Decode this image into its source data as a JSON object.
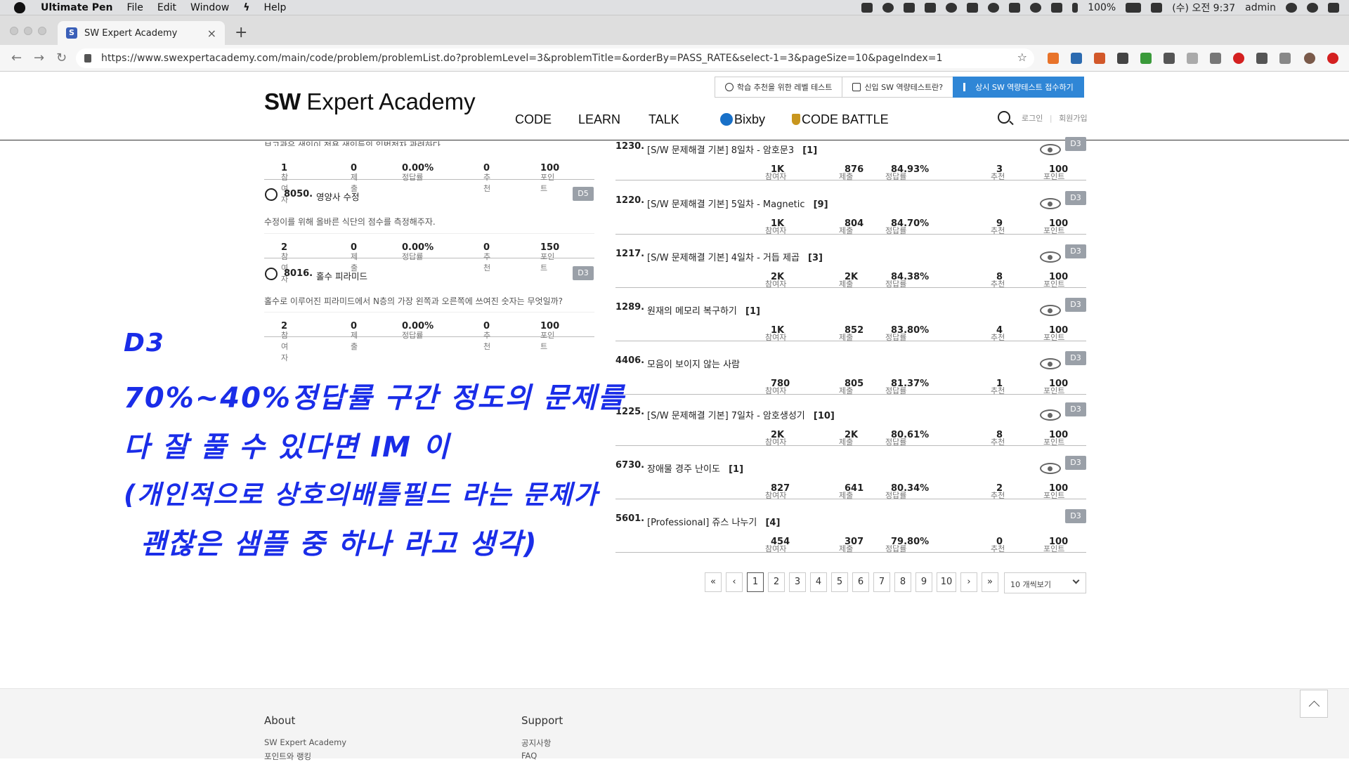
{
  "menubar": {
    "app": "Ultimate Pen",
    "items": [
      "File",
      "Edit",
      "Window",
      "Help"
    ],
    "battery": "100%",
    "clock": "(수) 오전 9:37",
    "user": "admin"
  },
  "browser": {
    "tab_title": "SW Expert Academy",
    "favicon_letter": "S",
    "new_tab": "+",
    "tab_close": "×",
    "url": "https://www.swexpertacademy.com/main/code/problem/problemList.do?problemLevel=3&problemTitle=&orderBy=PASS_RATE&select-1=3&pageSize=10&pageIndex=1"
  },
  "header": {
    "logo_bold": "SW",
    "logo_rest": " Expert Academy",
    "top_buttons": [
      "학습 추천을 위한 레벨 테스트",
      "신입 SW 역량테스트란?",
      "상시 SW 역량테스트 접수하기"
    ],
    "nav": [
      "CODE",
      "LEARN",
      "TALK",
      "Bixby",
      "CODE BATTLE"
    ],
    "login": "로그인",
    "signup": "회원가입",
    "sep": "|"
  },
  "stat_labels": {
    "participants": "참여자",
    "submissions": "제출",
    "pass_rate": "정답률",
    "recommend": "추천",
    "points": "포인트"
  },
  "left_list": {
    "partial_desc": "보고관은 색인이 전용 색인들의 입법전자 관련하다.",
    "first_stats": {
      "participants": "1",
      "submissions": "0",
      "pass_rate": "0.00%",
      "recommend": "0",
      "points": "100"
    },
    "problems": [
      {
        "num": "8050.",
        "title": "영양사 수정",
        "level": "D5",
        "desc": "수정이를 위해 올바른 식단의 점수를 측정해주자.",
        "participants": "2",
        "submissions": "0",
        "pass_rate": "0.00%",
        "recommend": "0",
        "points": "150"
      },
      {
        "num": "8016.",
        "title": "홀수 피라미드",
        "level": "D3",
        "desc": "홀수로 이루어진 피라미드에서 N층의 가장 왼쪽과 오른쪽에 쓰여진 숫자는 무엇일까?",
        "participants": "2",
        "submissions": "0",
        "pass_rate": "0.00%",
        "recommend": "0",
        "points": "100"
      }
    ]
  },
  "right_list": [
    {
      "num": "1230.",
      "title": "[S/W 문제해결 기본] 8일차 - 암호문3",
      "count": "[1]",
      "level": "D3",
      "participants": "1K",
      "submissions": "876",
      "pass_rate": "84.93%",
      "recommend": "3",
      "points": "100"
    },
    {
      "num": "1220.",
      "title": "[S/W 문제해결 기본] 5일차 - Magnetic",
      "count": "[9]",
      "level": "D3",
      "participants": "1K",
      "submissions": "804",
      "pass_rate": "84.70%",
      "recommend": "9",
      "points": "100"
    },
    {
      "num": "1217.",
      "title": "[S/W 문제해결 기본] 4일차 - 거듭 제곱",
      "count": "[3]",
      "level": "D3",
      "participants": "2K",
      "submissions": "2K",
      "pass_rate": "84.38%",
      "recommend": "8",
      "points": "100"
    },
    {
      "num": "1289.",
      "title": "원재의 메모리 복구하기",
      "count": "[1]",
      "level": "D3",
      "participants": "1K",
      "submissions": "852",
      "pass_rate": "83.80%",
      "recommend": "4",
      "points": "100"
    },
    {
      "num": "4406.",
      "title": "모음이 보이지 않는 사람",
      "count": "",
      "level": "D3",
      "participants": "780",
      "submissions": "805",
      "pass_rate": "81.37%",
      "recommend": "1",
      "points": "100"
    },
    {
      "num": "1225.",
      "title": "[S/W 문제해결 기본] 7일차 - 암호생성기",
      "count": "[10]",
      "level": "D3",
      "participants": "2K",
      "submissions": "2K",
      "pass_rate": "80.61%",
      "recommend": "8",
      "points": "100"
    },
    {
      "num": "6730.",
      "title": "장애물 경주 난이도",
      "count": "[1]",
      "level": "D3",
      "participants": "827",
      "submissions": "641",
      "pass_rate": "80.34%",
      "recommend": "2",
      "points": "100"
    },
    {
      "num": "5601.",
      "title": "[Professional] 쥬스 나누기",
      "count": "[4]",
      "level": "D3",
      "participants": "454",
      "submissions": "307",
      "pass_rate": "79.80%",
      "recommend": "0",
      "points": "100"
    }
  ],
  "pagination": {
    "first": "«",
    "prev": "‹",
    "next": "›",
    "last": "»",
    "pages": [
      "1",
      "2",
      "3",
      "4",
      "5",
      "6",
      "7",
      "8",
      "9",
      "10"
    ],
    "current": "1",
    "page_size": "10 개씩보기"
  },
  "annotation": {
    "lines": [
      "D3",
      "70%~40%정답률 구간 정도의 문제를",
      "다 잘 풀 수 있다면 IM 이",
      "(개인적으로 상호의배틀필드 라는 문제가",
      "괜찮은 샘플 중 하나 라고 생각)"
    ]
  },
  "footer": {
    "about": "About",
    "about_links": [
      "SW Expert Academy",
      "포인트와 랭킹"
    ],
    "support": "Support",
    "support_links": [
      "공지사항",
      "FAQ"
    ]
  }
}
